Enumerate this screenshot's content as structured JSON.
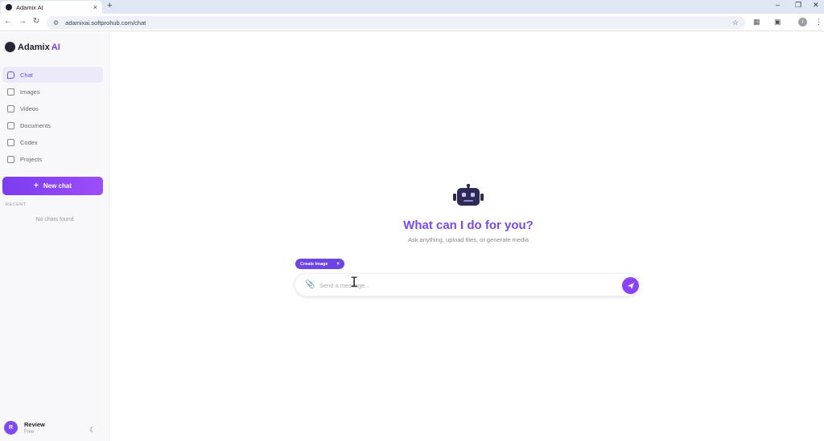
{
  "browser": {
    "tab_title": "Adamix AI",
    "tab_close": "×",
    "new_tab": "+",
    "url": "adamixai.softprohub.com/chat",
    "account_initial": "I"
  },
  "app": {
    "logo_main": "Adamix",
    "logo_ai": "AI"
  },
  "sidebar": {
    "items": [
      {
        "label": "Chat",
        "active": true
      },
      {
        "label": "Images",
        "active": false
      },
      {
        "label": "Videos",
        "active": false
      },
      {
        "label": "Documents",
        "active": false
      },
      {
        "label": "Codex",
        "active": false
      },
      {
        "label": "Projects",
        "active": false
      }
    ],
    "new_chat_label": "New chat",
    "new_chat_icon": "+",
    "recent_label": "RECENT",
    "empty_label": "No chats found"
  },
  "profile": {
    "initial": "R",
    "name": "Review",
    "plan": "Free"
  },
  "main": {
    "headline": "What can I do for you?",
    "subline": "Ask anything, upload files, or generate media",
    "chip_label": "Create Image",
    "chip_close": "×",
    "input_placeholder": "Send a message..."
  },
  "colors": {
    "accent": "#7c3aed",
    "accent_gradient_start": "#7a3cf0",
    "accent_gradient_end": "#9d4ef8"
  }
}
